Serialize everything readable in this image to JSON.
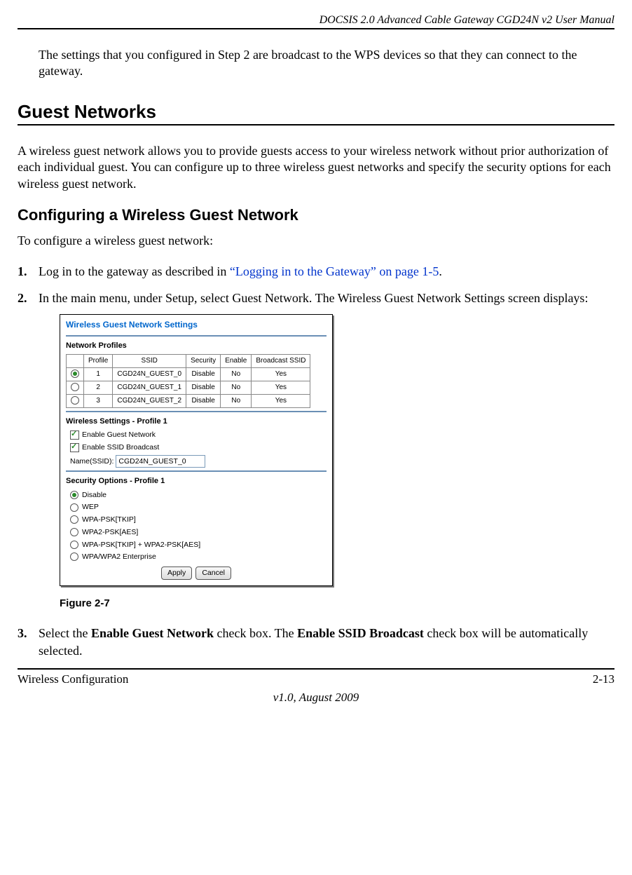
{
  "header": {
    "doc_title": "DOCSIS 2.0 Advanced Cable Gateway CGD24N v2 User Manual"
  },
  "intro": "The settings that you configured in Step 2 are broadcast to the WPS devices so that they can connect to the gateway.",
  "section": {
    "title": "Guest Networks",
    "desc": "A wireless guest network allows you to provide guests access to your wireless network without prior authorization of each individual guest. You can configure up to three wireless guest networks and specify the security options for each wireless guest network."
  },
  "subsection": {
    "title": "Configuring a Wireless Guest Network",
    "lead": "To configure a wireless guest network:"
  },
  "steps": {
    "s1_pre": "Log in to the gateway as described in ",
    "s1_link": "“Logging in to the Gateway” on page 1-5",
    "s1_post": ".",
    "s2": "In the main menu, under Setup, select Guest Network. The Wireless Guest Network Settings screen displays:",
    "s3_pre": "Select the ",
    "s3_b1": "Enable Guest Network",
    "s3_mid": " check box. The ",
    "s3_b2": "Enable SSID Broadcast",
    "s3_post": " check box will be automatically selected."
  },
  "screenshot": {
    "title": "Wireless Guest Network Settings",
    "profiles_heading": "Network Profiles",
    "cols": {
      "c0": "",
      "c1": "Profile",
      "c2": "SSID",
      "c3": "Security",
      "c4": "Enable",
      "c5": "Broadcast SSID"
    },
    "rows": [
      {
        "sel": true,
        "profile": "1",
        "ssid": "CGD24N_GUEST_0",
        "security": "Disable",
        "enable": "No",
        "bcast": "Yes"
      },
      {
        "sel": false,
        "profile": "2",
        "ssid": "CGD24N_GUEST_1",
        "security": "Disable",
        "enable": "No",
        "bcast": "Yes"
      },
      {
        "sel": false,
        "profile": "3",
        "ssid": "CGD24N_GUEST_2",
        "security": "Disable",
        "enable": "No",
        "bcast": "Yes"
      }
    ],
    "ws_heading": "Wireless Settings - Profile 1",
    "chk_enable_guest": "Enable Guest Network",
    "chk_enable_ssid": "Enable SSID Broadcast",
    "name_label": "Name(SSID):",
    "name_value": "CGD24N_GUEST_0",
    "sec_heading": "Security Options - Profile 1",
    "sec_opts": {
      "o0": "Disable",
      "o1": "WEP",
      "o2": "WPA-PSK[TKIP]",
      "o3": "WPA2-PSK[AES]",
      "o4": "WPA-PSK[TKIP] + WPA2-PSK[AES]",
      "o5": "WPA/WPA2 Enterprise"
    },
    "btn_apply": "Apply",
    "btn_cancel": "Cancel"
  },
  "figure_caption": "Figure 2-7",
  "footer": {
    "left": "Wireless Configuration",
    "right": "2-13",
    "version": "v1.0, August 2009"
  }
}
